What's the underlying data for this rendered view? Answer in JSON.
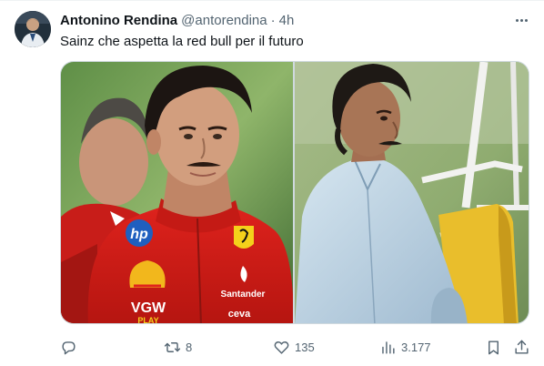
{
  "tweet": {
    "author_name": "Antonino Rendina",
    "author_handle": "@antorendina",
    "separator": "·",
    "time": "4h",
    "text": "Sainz che aspetta la red bull per il futuro"
  },
  "media": {
    "left_photo_logos": {
      "hp": "hp",
      "vgw": "VGW",
      "vgw_sub": "PLAY",
      "santander": "Santander",
      "ceva": "ceva"
    }
  },
  "actions": {
    "reply": {
      "icon": "reply-icon",
      "count": ""
    },
    "repost": {
      "icon": "repost-icon",
      "count": "8"
    },
    "like": {
      "icon": "heart-icon",
      "count": "135"
    },
    "views": {
      "icon": "views-icon",
      "count": "3.177"
    },
    "bookmark": {
      "icon": "bookmark-icon"
    },
    "share": {
      "icon": "share-icon"
    }
  },
  "colors": {
    "text": "#0f1419",
    "secondary": "#536471",
    "ferrari_red": "#d81e1a"
  }
}
